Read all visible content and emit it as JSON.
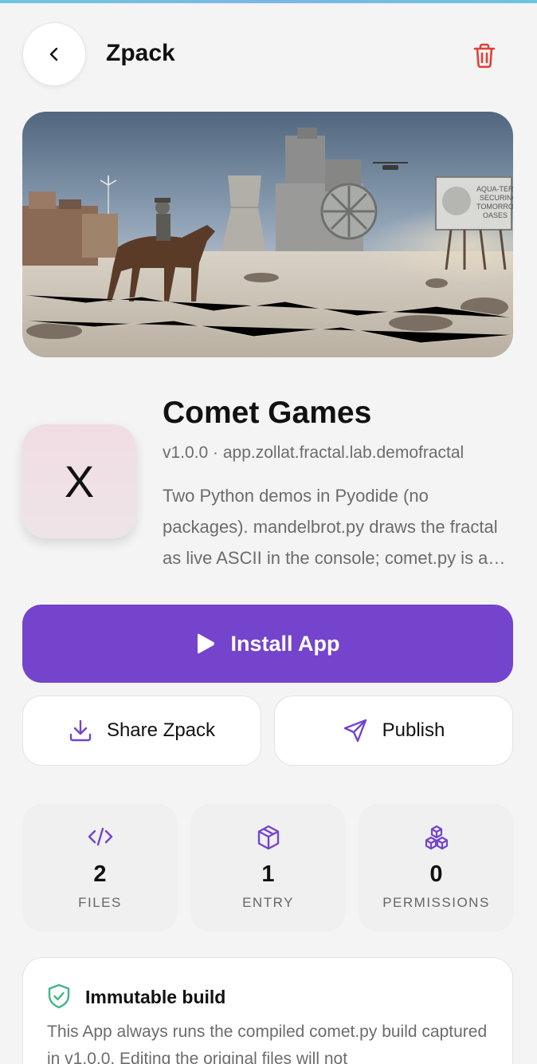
{
  "header": {
    "title": "Zpack",
    "back_icon": "chevron-left-icon",
    "delete_icon": "trash-icon"
  },
  "colors": {
    "accent": "#7444cc",
    "danger": "#e0403a",
    "shield": "#3fb685"
  },
  "app": {
    "icon_letter": "X",
    "name": "Comet Games",
    "meta": "v1.0.0 · app.zollat.fractal.lab.demofractal",
    "description": "Two Python demos in Pyodide (no packages). mandelbrot.py draws the fractal as live ASCII in the console; comet.py is a small game."
  },
  "actions": {
    "install_label": "Install App",
    "share_label": "Share Zpack",
    "publish_label": "Publish"
  },
  "stats": [
    {
      "value": "2",
      "label": "FILES",
      "icon": "code-icon"
    },
    {
      "value": "1",
      "label": "ENTRY",
      "icon": "cube-icon"
    },
    {
      "value": "0",
      "label": "PERMISSIONS",
      "icon": "cubes-icon"
    }
  ],
  "immutable": {
    "title": "Immutable build",
    "body": "This App always runs the compiled comet.py build captured in v1.0.0. Editing the original files will not"
  }
}
